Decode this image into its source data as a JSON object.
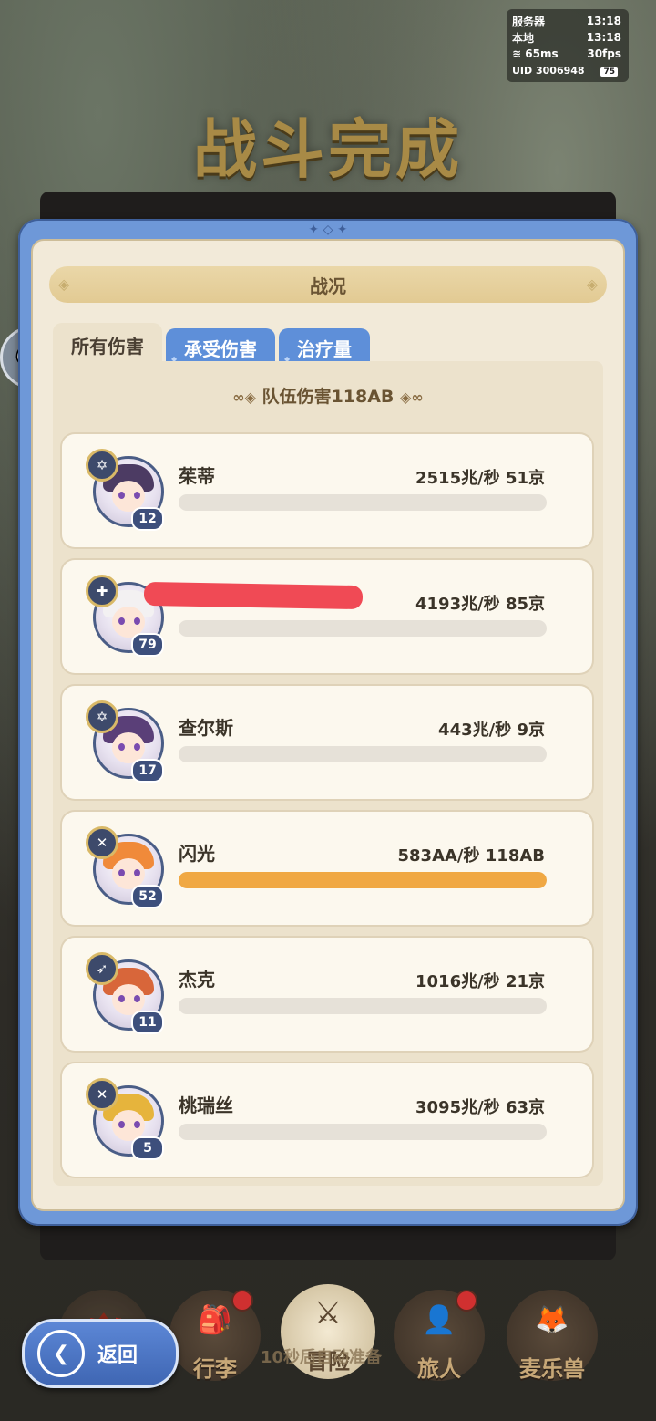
{
  "status": {
    "server_label": "服务器",
    "server_time": "13:18",
    "local_label": "本地",
    "local_time": "13:18",
    "ping": "65ms",
    "fps": "30fps",
    "uid": "UID 3006948",
    "battery": "75"
  },
  "title": "战斗完成",
  "panel": {
    "header": "战况",
    "tabs": [
      {
        "label": "所有伤害",
        "active": true
      },
      {
        "label": "承受伤害",
        "active": false
      },
      {
        "label": "治疗量",
        "active": false
      }
    ],
    "team_label": "队伍伤害118AB"
  },
  "members": [
    {
      "name": "茱蒂",
      "stat": "2515兆/秒  51京",
      "level": "12",
      "badge_icon": "compass-icon",
      "progress": 0.0,
      "hair": "#4c3b63"
    },
    {
      "name": "",
      "stat": "4193兆/秒  85京",
      "level": "79",
      "badge_icon": "cross-icon",
      "progress": 0.0,
      "hair": "#f3f1f2",
      "redacted": true
    },
    {
      "name": "查尔斯",
      "stat": "443兆/秒  9京",
      "level": "17",
      "badge_icon": "compass-icon",
      "progress": 0.0,
      "hair": "#5a3f78"
    },
    {
      "name": "闪光",
      "stat": "583AA/秒  118AB",
      "level": "52",
      "badge_icon": "sword-icon",
      "progress": 1.0,
      "hair": "#f08a3a"
    },
    {
      "name": "杰克",
      "stat": "1016兆/秒  21京",
      "level": "11",
      "badge_icon": "bow-icon",
      "progress": 0.0,
      "hair": "#d8663a"
    },
    {
      "name": "桃瑞丝",
      "stat": "3095兆/秒  63京",
      "level": "5",
      "badge_icon": "sword-icon",
      "progress": 0.0,
      "hair": "#e6b43c"
    }
  ],
  "bottom_nav": {
    "items": [
      {
        "label": "",
        "name": "castle"
      },
      {
        "label": "行李"
      },
      {
        "label": "冒险"
      },
      {
        "label": "旅人"
      },
      {
        "label": "麦乐兽"
      }
    ],
    "countdown": "10秒后自动准备"
  },
  "back_label": "返回"
}
